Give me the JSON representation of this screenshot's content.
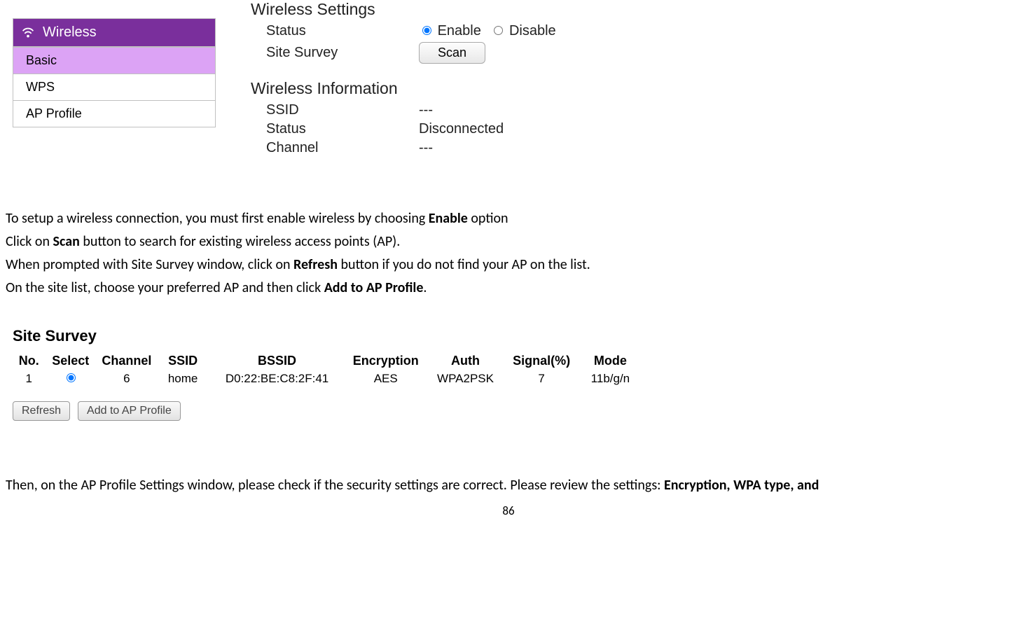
{
  "nav": {
    "header": "Wireless",
    "items": [
      "Basic",
      "WPS",
      "AP Profile"
    ],
    "selected_index": 0
  },
  "wireless_settings": {
    "title": "Wireless Settings",
    "status_label": "Status",
    "enable_label": "Enable",
    "disable_label": "Disable",
    "status_value": "enable",
    "site_survey_label": "Site Survey",
    "scan_label": "Scan"
  },
  "wireless_info": {
    "title": "Wireless Information",
    "ssid_label": "SSID",
    "ssid_value": "---",
    "status_label": "Status",
    "status_value": "Disconnected",
    "channel_label": "Channel",
    "channel_value": "---"
  },
  "instructions": {
    "p1_a": "To setup a wireless connection, you must first enable wireless by choosing ",
    "p1_b": "Enable",
    "p1_c": " option",
    "p2_a": "Click on ",
    "p2_b": "Scan",
    "p2_c": " button to search for existing wireless access points (AP).",
    "p3_a": "When prompted with Site Survey window, click on ",
    "p3_b": "Refresh",
    "p3_c": " button if you do not find your AP on the list.",
    "p4_a": "On the site list, choose your preferred AP and then click ",
    "p4_b": "Add to AP Profile",
    "p4_c": "."
  },
  "site_survey": {
    "title": "Site Survey",
    "headers": [
      "No.",
      "Select",
      "Channel",
      "SSID",
      "BSSID",
      "Encryption",
      "Auth",
      "Signal(%)",
      "Mode"
    ],
    "rows": [
      {
        "no": "1",
        "channel": "6",
        "ssid": "home",
        "bssid": "D0:22:BE:C8:2F:41",
        "encryption": "AES",
        "auth": "WPA2PSK",
        "signal": "7",
        "mode": "11b/g/n"
      }
    ],
    "refresh_label": "Refresh",
    "add_label": "Add to AP Profile"
  },
  "closing": {
    "a": "Then, on the AP Profile Settings window, please check if the security settings are correct. Please review the settings: ",
    "b": "Encryption, WPA type, and"
  },
  "page_number": "86"
}
